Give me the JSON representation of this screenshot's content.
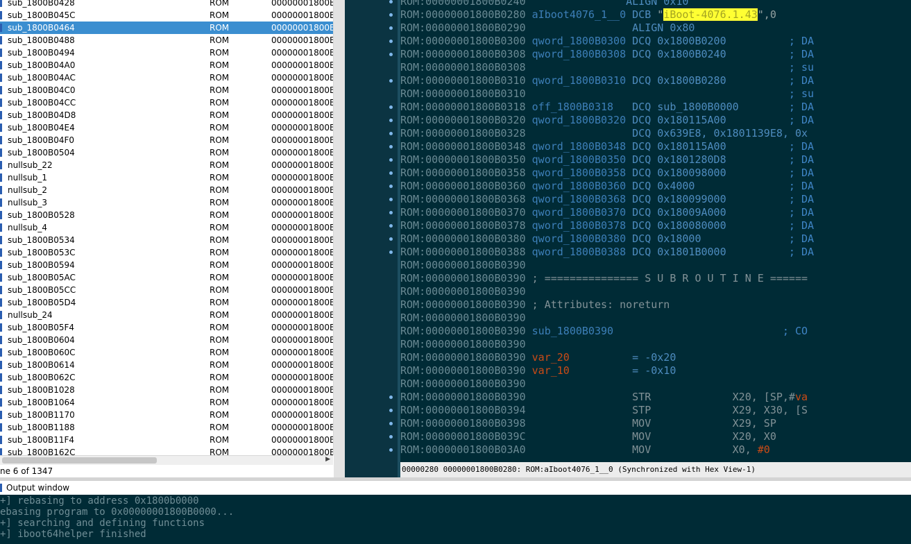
{
  "functions": {
    "rows": [
      {
        "name": "sub_1800B0428",
        "segment": "ROM",
        "start": "00000001800B",
        "selected": false
      },
      {
        "name": "sub_1800B045C",
        "segment": "ROM",
        "start": "00000001800B",
        "selected": false
      },
      {
        "name": "sub_1800B0464",
        "segment": "ROM",
        "start": "00000001800B",
        "selected": true
      },
      {
        "name": "sub_1800B0488",
        "segment": "ROM",
        "start": "00000001800B",
        "selected": false
      },
      {
        "name": "sub_1800B0494",
        "segment": "ROM",
        "start": "00000001800B",
        "selected": false
      },
      {
        "name": "sub_1800B04A0",
        "segment": "ROM",
        "start": "00000001800B",
        "selected": false
      },
      {
        "name": "sub_1800B04AC",
        "segment": "ROM",
        "start": "00000001800B",
        "selected": false
      },
      {
        "name": "sub_1800B04C0",
        "segment": "ROM",
        "start": "00000001800B",
        "selected": false
      },
      {
        "name": "sub_1800B04CC",
        "segment": "ROM",
        "start": "00000001800B",
        "selected": false
      },
      {
        "name": "sub_1800B04D8",
        "segment": "ROM",
        "start": "00000001800B",
        "selected": false
      },
      {
        "name": "sub_1800B04E4",
        "segment": "ROM",
        "start": "00000001800B",
        "selected": false
      },
      {
        "name": "sub_1800B04F0",
        "segment": "ROM",
        "start": "00000001800B",
        "selected": false
      },
      {
        "name": "sub_1800B0504",
        "segment": "ROM",
        "start": "00000001800B",
        "selected": false
      },
      {
        "name": "nullsub_22",
        "segment": "ROM",
        "start": "00000001800B",
        "selected": false
      },
      {
        "name": "nullsub_1",
        "segment": "ROM",
        "start": "00000001800B",
        "selected": false
      },
      {
        "name": "nullsub_2",
        "segment": "ROM",
        "start": "00000001800B",
        "selected": false
      },
      {
        "name": "nullsub_3",
        "segment": "ROM",
        "start": "00000001800B",
        "selected": false
      },
      {
        "name": "sub_1800B0528",
        "segment": "ROM",
        "start": "00000001800B",
        "selected": false
      },
      {
        "name": "nullsub_4",
        "segment": "ROM",
        "start": "00000001800B",
        "selected": false
      },
      {
        "name": "sub_1800B0534",
        "segment": "ROM",
        "start": "00000001800B",
        "selected": false
      },
      {
        "name": "sub_1800B053C",
        "segment": "ROM",
        "start": "00000001800B",
        "selected": false
      },
      {
        "name": "sub_1800B0594",
        "segment": "ROM",
        "start": "00000001800B",
        "selected": false
      },
      {
        "name": "sub_1800B05AC",
        "segment": "ROM",
        "start": "00000001800B",
        "selected": false
      },
      {
        "name": "sub_1800B05CC",
        "segment": "ROM",
        "start": "00000001800B",
        "selected": false
      },
      {
        "name": "sub_1800B05D4",
        "segment": "ROM",
        "start": "00000001800B",
        "selected": false
      },
      {
        "name": "nullsub_24",
        "segment": "ROM",
        "start": "00000001800B",
        "selected": false
      },
      {
        "name": "sub_1800B05F4",
        "segment": "ROM",
        "start": "00000001800B",
        "selected": false
      },
      {
        "name": "sub_1800B0604",
        "segment": "ROM",
        "start": "00000001800B",
        "selected": false
      },
      {
        "name": "sub_1800B060C",
        "segment": "ROM",
        "start": "00000001800B",
        "selected": false
      },
      {
        "name": "sub_1800B0614",
        "segment": "ROM",
        "start": "00000001800B",
        "selected": false
      },
      {
        "name": "sub_1800B062C",
        "segment": "ROM",
        "start": "00000001800B",
        "selected": false
      },
      {
        "name": "sub_1800B1028",
        "segment": "ROM",
        "start": "00000001800B",
        "selected": false
      },
      {
        "name": "sub_1800B1064",
        "segment": "ROM",
        "start": "00000001800B",
        "selected": false
      },
      {
        "name": "sub_1800B1170",
        "segment": "ROM",
        "start": "00000001800B",
        "selected": false
      },
      {
        "name": "sub_1800B1188",
        "segment": "ROM",
        "start": "00000001800B",
        "selected": false
      },
      {
        "name": "sub_1800B11F4",
        "segment": "ROM",
        "start": "00000001800B",
        "selected": false
      },
      {
        "name": "sub_1800B162C",
        "segment": "ROM",
        "start": "00000001800B",
        "selected": false
      }
    ],
    "status_text": "ne 6 of 1347"
  },
  "disassembly": {
    "lines": [
      [
        {
          "t": "ROM:00000001800B0240 ",
          "c": "c-addr"
        },
        {
          "t": "               ALIGN 0x10",
          "c": "c-op"
        }
      ],
      [
        {
          "t": "ROM:00000001800B0280 ",
          "c": "c-addr"
        },
        {
          "t": "aIboot4076_1__0 ",
          "c": "c-lbl"
        },
        {
          "t": "DCB ",
          "c": "c-op"
        },
        {
          "t": "\"",
          "c": "c-plain"
        },
        {
          "t": "iBoot-4076.1.43",
          "c": "c-str"
        },
        {
          "t": "\",0",
          "c": "c-plain"
        }
      ],
      [
        {
          "t": "ROM:00000001800B0290 ",
          "c": "c-addr"
        },
        {
          "t": "                ALIGN 0x80",
          "c": "c-op"
        }
      ],
      [
        {
          "t": "ROM:00000001800B0300 ",
          "c": "c-addr"
        },
        {
          "t": "qword_1800B0300 ",
          "c": "c-lbl"
        },
        {
          "t": "DCQ 0x1800B0200",
          "c": "c-op"
        },
        {
          "t": "          ; DA",
          "c": "c-cmt"
        }
      ],
      [
        {
          "t": "ROM:00000001800B0308 ",
          "c": "c-addr"
        },
        {
          "t": "qword_1800B0308 ",
          "c": "c-lbl"
        },
        {
          "t": "DCQ 0x1800B0240",
          "c": "c-op"
        },
        {
          "t": "          ; DA",
          "c": "c-cmt"
        }
      ],
      [
        {
          "t": "ROM:00000001800B0308 ",
          "c": "c-addr"
        },
        {
          "t": "                                         ; su",
          "c": "c-cmt"
        }
      ],
      [
        {
          "t": "ROM:00000001800B0310 ",
          "c": "c-addr"
        },
        {
          "t": "qword_1800B0310 ",
          "c": "c-lbl"
        },
        {
          "t": "DCQ 0x1800B0280",
          "c": "c-op"
        },
        {
          "t": "          ; DA",
          "c": "c-cmt"
        }
      ],
      [
        {
          "t": "ROM:00000001800B0310 ",
          "c": "c-addr"
        },
        {
          "t": "                                         ; su",
          "c": "c-cmt"
        }
      ],
      [
        {
          "t": "ROM:00000001800B0318 ",
          "c": "c-addr"
        },
        {
          "t": "off_1800B0318   ",
          "c": "c-lbl"
        },
        {
          "t": "DCQ sub_1800B0000",
          "c": "c-op"
        },
        {
          "t": "        ; DA",
          "c": "c-cmt"
        }
      ],
      [
        {
          "t": "ROM:00000001800B0320 ",
          "c": "c-addr"
        },
        {
          "t": "qword_1800B0320 ",
          "c": "c-lbl"
        },
        {
          "t": "DCQ 0x180115A00",
          "c": "c-op"
        },
        {
          "t": "          ; DA",
          "c": "c-cmt"
        }
      ],
      [
        {
          "t": "ROM:00000001800B0328 ",
          "c": "c-addr"
        },
        {
          "t": "                DCQ 0x639E8, 0x1801139E8, 0x",
          "c": "c-op"
        }
      ],
      [
        {
          "t": "ROM:00000001800B0348 ",
          "c": "c-addr"
        },
        {
          "t": "qword_1800B0348 ",
          "c": "c-lbl"
        },
        {
          "t": "DCQ 0x180115A00",
          "c": "c-op"
        },
        {
          "t": "          ; DA",
          "c": "c-cmt"
        }
      ],
      [
        {
          "t": "ROM:00000001800B0350 ",
          "c": "c-addr"
        },
        {
          "t": "qword_1800B0350 ",
          "c": "c-lbl"
        },
        {
          "t": "DCQ 0x1801280D8",
          "c": "c-op"
        },
        {
          "t": "          ; DA",
          "c": "c-cmt"
        }
      ],
      [
        {
          "t": "ROM:00000001800B0358 ",
          "c": "c-addr"
        },
        {
          "t": "qword_1800B0358 ",
          "c": "c-lbl"
        },
        {
          "t": "DCQ 0x180098000",
          "c": "c-op"
        },
        {
          "t": "          ; DA",
          "c": "c-cmt"
        }
      ],
      [
        {
          "t": "ROM:00000001800B0360 ",
          "c": "c-addr"
        },
        {
          "t": "qword_1800B0360 ",
          "c": "c-lbl"
        },
        {
          "t": "DCQ 0x4000",
          "c": "c-op"
        },
        {
          "t": "               ; DA",
          "c": "c-cmt"
        }
      ],
      [
        {
          "t": "ROM:00000001800B0368 ",
          "c": "c-addr"
        },
        {
          "t": "qword_1800B0368 ",
          "c": "c-lbl"
        },
        {
          "t": "DCQ 0x180099000",
          "c": "c-op"
        },
        {
          "t": "          ; DA",
          "c": "c-cmt"
        }
      ],
      [
        {
          "t": "ROM:00000001800B0370 ",
          "c": "c-addr"
        },
        {
          "t": "qword_1800B0370 ",
          "c": "c-lbl"
        },
        {
          "t": "DCQ 0x18009A000",
          "c": "c-op"
        },
        {
          "t": "          ; DA",
          "c": "c-cmt"
        }
      ],
      [
        {
          "t": "ROM:00000001800B0378 ",
          "c": "c-addr"
        },
        {
          "t": "qword_1800B0378 ",
          "c": "c-lbl"
        },
        {
          "t": "DCQ 0x180080000",
          "c": "c-op"
        },
        {
          "t": "          ; DA",
          "c": "c-cmt"
        }
      ],
      [
        {
          "t": "ROM:00000001800B0380 ",
          "c": "c-addr"
        },
        {
          "t": "qword_1800B0380 ",
          "c": "c-lbl"
        },
        {
          "t": "DCQ 0x18000",
          "c": "c-op"
        },
        {
          "t": "              ; DA",
          "c": "c-cmt"
        }
      ],
      [
        {
          "t": "ROM:00000001800B0388 ",
          "c": "c-addr"
        },
        {
          "t": "qword_1800B0388 ",
          "c": "c-lbl"
        },
        {
          "t": "DCQ 0x1801B0000",
          "c": "c-op"
        },
        {
          "t": "          ; DA",
          "c": "c-cmt"
        }
      ],
      [
        {
          "t": "ROM:00000001800B0390",
          "c": "c-addr"
        }
      ],
      [
        {
          "t": "ROM:00000001800B0390 ",
          "c": "c-addr"
        },
        {
          "t": "; =============== S U B R O U T I N E ======",
          "c": "c-mn"
        }
      ],
      [
        {
          "t": "ROM:00000001800B0390",
          "c": "c-addr"
        }
      ],
      [
        {
          "t": "ROM:00000001800B0390 ",
          "c": "c-addr"
        },
        {
          "t": "; Attributes: noreturn",
          "c": "c-mn"
        }
      ],
      [
        {
          "t": "ROM:00000001800B0390",
          "c": "c-addr"
        }
      ],
      [
        {
          "t": "ROM:00000001800B0390 ",
          "c": "c-addr"
        },
        {
          "t": "sub_1800B0390",
          "c": "c-lbl"
        },
        {
          "t": "                           ; CO",
          "c": "c-cmt"
        }
      ],
      [
        {
          "t": "ROM:00000001800B0390",
          "c": "c-addr"
        }
      ],
      [
        {
          "t": "ROM:00000001800B0390 ",
          "c": "c-addr"
        },
        {
          "t": "var_20",
          "c": "c-var"
        },
        {
          "t": "          = -0x20",
          "c": "c-def"
        }
      ],
      [
        {
          "t": "ROM:00000001800B0390 ",
          "c": "c-addr"
        },
        {
          "t": "var_10",
          "c": "c-var"
        },
        {
          "t": "          = -0x10",
          "c": "c-def"
        }
      ],
      [
        {
          "t": "ROM:00000001800B0390",
          "c": "c-addr"
        }
      ],
      [
        {
          "t": "ROM:00000001800B0390 ",
          "c": "c-addr"
        },
        {
          "t": "                STR             X20, [SP,#",
          "c": "c-mn"
        },
        {
          "t": "va",
          "c": "c-var"
        }
      ],
      [
        {
          "t": "ROM:00000001800B0394 ",
          "c": "c-addr"
        },
        {
          "t": "                STP             X29, X30, [S",
          "c": "c-mn"
        }
      ],
      [
        {
          "t": "ROM:00000001800B0398 ",
          "c": "c-addr"
        },
        {
          "t": "                MOV             X29, SP",
          "c": "c-mn"
        }
      ],
      [
        {
          "t": "ROM:00000001800B039C ",
          "c": "c-addr"
        },
        {
          "t": "                MOV             X20, X0",
          "c": "c-mn"
        }
      ],
      [
        {
          "t": "ROM:00000001800B03A0 ",
          "c": "c-addr"
        },
        {
          "t": "                MOV             X0, ",
          "c": "c-mn"
        },
        {
          "t": "#0",
          "c": "c-var"
        }
      ]
    ],
    "status_text": "00000280 00000001800B0280: ROM:aIboot4076_1__0 (Synchronized with Hex View-1)"
  },
  "output": {
    "title": "Output window",
    "lines": [
      "+] rebasing to address 0x1800b0000",
      "ebasing program to 0x00000001800B0000...",
      "+] searching and defining functions",
      "+] iboot64helper finished"
    ]
  },
  "colors": {
    "selection": "#3b8ed0",
    "disasm_bg": "#002b36",
    "string_highlight": "#ffff33"
  }
}
